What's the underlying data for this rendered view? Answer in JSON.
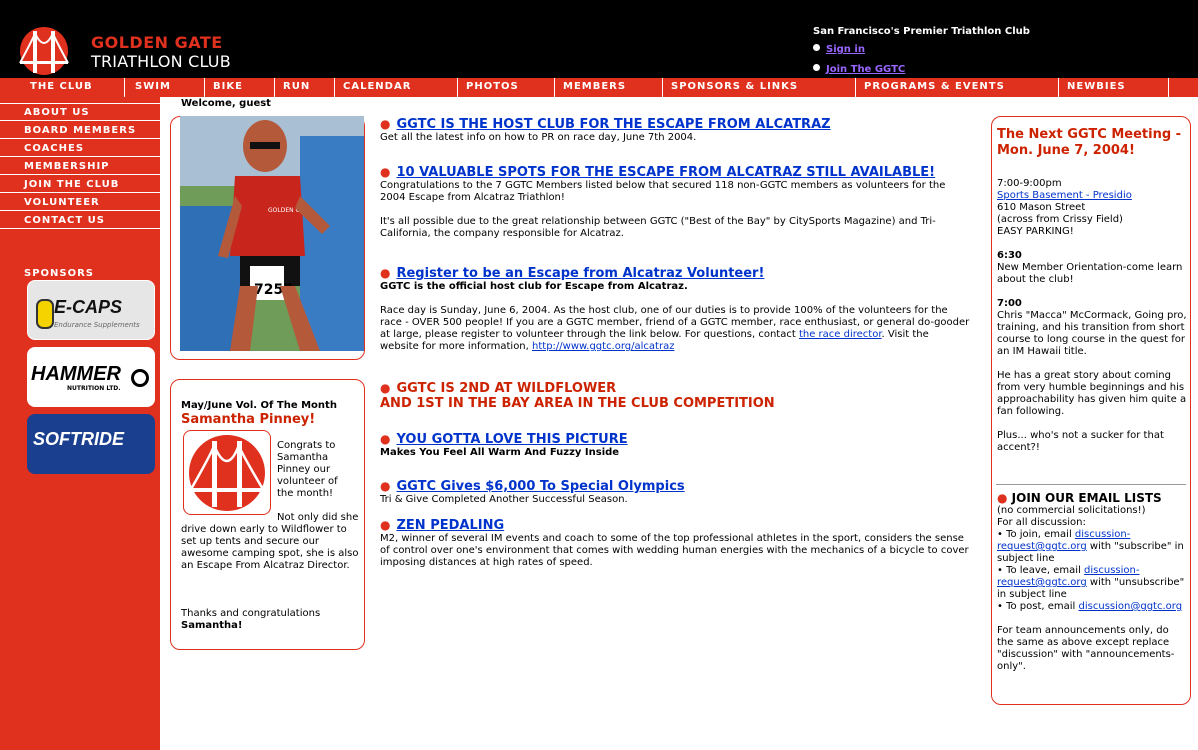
{
  "header": {
    "logo_line1": "GOLDEN GATE",
    "logo_line2": "TRIATHLON CLUB",
    "tagline": "San Francisco's Premier Triathlon Club",
    "sign_in": "Sign in",
    "join": "Join The GGTC"
  },
  "nav": [
    "THE CLUB",
    "SWIM",
    "BIKE",
    "RUN",
    "CALENDAR",
    "PHOTOS",
    "MEMBERS",
    "SPONSORS & LINKS",
    "PROGRAMS & EVENTS",
    "NEWBIES"
  ],
  "sidebar": {
    "items": [
      "ABOUT US",
      "BOARD MEMBERS",
      "COACHES",
      "MEMBERSHIP",
      "JOIN THE CLUB",
      "VOLUNTEER",
      "CONTACT US"
    ],
    "sponsors_title": "SPONSORS",
    "sponsors": [
      "E-CAPS",
      "Endurance Supplements",
      "HAMMER",
      "NUTRITION LTD.",
      "SOFTRIDE"
    ]
  },
  "welcome": "Welcome, guest",
  "photo": {
    "bib": "7255",
    "jersey": "GOLDEN GATE"
  },
  "volunteer_box": {
    "title": "May/June Vol. Of The Month",
    "name": "Samantha Pinney!",
    "text1": "Congrats to Samantha Pinney our volunteer of the month!",
    "text2": "Not only did she drive down early to Wildflower to set up tents and secure our awesome camping spot, she is also an Escape From Alcatraz Director.",
    "thanks": "Thanks and congratulations",
    "thanks_name": "Samantha!"
  },
  "news": [
    {
      "headline": "GGTC IS THE HOST CLUB FOR THE ESCAPE FROM ALCATRAZ",
      "body": "Get all the latest info on how to PR on race day, June 7th 2004."
    },
    {
      "headline": "10 VALUABLE SPOTS FOR THE ESCAPE FROM ALCATRAZ STILL AVAILABLE!",
      "body": "Congratulations to the 7 GGTC Members listed below that secured 118 non-GGTC members as volunteers for the 2004 Escape from Alcatraz Triathlon!",
      "body2": "It's all possible due to the great relationship between GGTC (\"Best of the Bay\" by CitySports Magazine) and Tri-California, the company responsible for Alcatraz."
    },
    {
      "headline": "Register to be an Escape from Alcatraz Volunteer!",
      "subhead": "GGTC is the official host club for Escape from Alcatraz.",
      "body": "Race day is Sunday, June 6, 2004. As the host club, one of our duties is to provide 100% of the volunteers for the race - OVER 500 people! If you are a GGTC member, friend of a GGTC member, race enthusiast, or general do-gooder at large, please register to volunteer through the link below. For questions, contact",
      "link1": "the race director",
      "body_mid": ". Visit the website for more information,",
      "link2": "http://www.ggtc.org/alcatraz"
    },
    {
      "headline1": "GGTC IS 2ND AT WILDFLOWER",
      "headline2": "AND 1ST IN THE BAY AREA IN THE CLUB COMPETITION"
    },
    {
      "headline": "YOU GOTTA LOVE THIS PICTURE",
      "subhead": "Makes You Feel All Warm And Fuzzy Inside"
    },
    {
      "headline": "GGTC Gives $6,000 To Special Olympics",
      "body": "Tri & Give Completed Another Successful Season."
    },
    {
      "headline": "ZEN PEDALING",
      "body": "M2, winner of several IM events and coach to some of the top professional athletes in the sport, considers the sense of control over one's environment that comes with wedding human energies with the mechanics of a bicycle to cover imposing distances at high rates of speed."
    }
  ],
  "meeting": {
    "title": "The Next GGTC Meeting - Mon. June 7, 2004!",
    "time": "7:00-9:00pm",
    "venue_link": "Sports Basement - Presidio",
    "address1": "610 Mason Street",
    "address2": "(across from Crissy Field)",
    "parking": "EASY PARKING!",
    "t1": "6:30",
    "t1_text": "New Member Orientation-come learn about the club!",
    "t2": "7:00",
    "t2_text": "Chris \"Macca\" McCormack, Going pro, training, and his transition from short course to long course in the quest for an IM Hawaii title.",
    "story": "He has a great story about coming from very humble beginnings and his approachability has given him quite a fan following.",
    "plus": "Plus... who's not a sucker for that accent?!"
  },
  "email": {
    "title": "JOIN OUR EMAIL LISTS",
    "line1": "(no commercial solicitations!)",
    "line2": "For all discussion:",
    "join_pre": "• To join, email",
    "join_link": "discussion-request@ggtc.org",
    "join_post": "with \"subscribe\" in subject line",
    "leave_pre": "• To leave, email",
    "leave_link": "discussion-request@ggtc.org",
    "leave_post": "with \"unsubscribe\" in subject line",
    "post_pre": "• To post, email",
    "post_link": "discussion@ggtc.org",
    "team": "For team announcements only, do the same as above except replace \"discussion\" with \"announcements-only\"."
  }
}
